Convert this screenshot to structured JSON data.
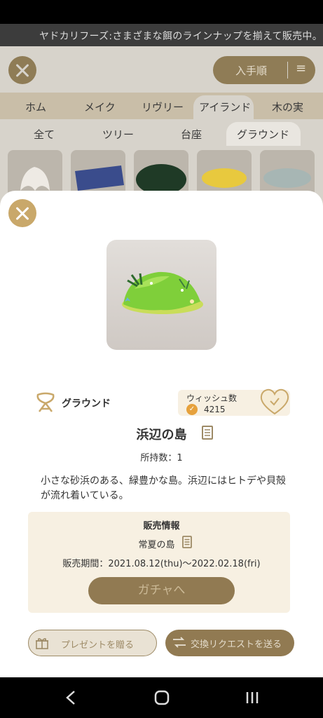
{
  "ticker": {
    "text": "ヤドカリフーズ:さまざまな餌のラインナップを揃えて販売中。"
  },
  "background": {
    "sort_label": "入手順",
    "categories": [
      "ホム",
      "メイク",
      "リヴリー",
      "アイランド",
      "木の実"
    ],
    "subcategories": [
      "全て",
      "ツリー",
      "台座",
      "グラウンド"
    ]
  },
  "item": {
    "category": "グラウンド",
    "wish_label": "ウィッシュ数",
    "wish_count": "4215",
    "name": "浜辺の島",
    "owned": "所持数：1",
    "description": "小さな砂浜のある、緑豊かな島。浜辺にはヒトデや貝殻が流れ着いている。"
  },
  "sale": {
    "title": "販売情報",
    "gacha_name": "常夏の島",
    "period": "販売期間：2021.08.12(thu)〜2022.02.18(fri)",
    "gacha_button": "ガチャへ"
  },
  "actions": {
    "present": "プレゼントを贈る",
    "trade": "交換リクエストを送る"
  },
  "colors": {
    "accent": "#c9a86a",
    "panel": "#f7f0e2",
    "button_dark": "#917a52"
  }
}
